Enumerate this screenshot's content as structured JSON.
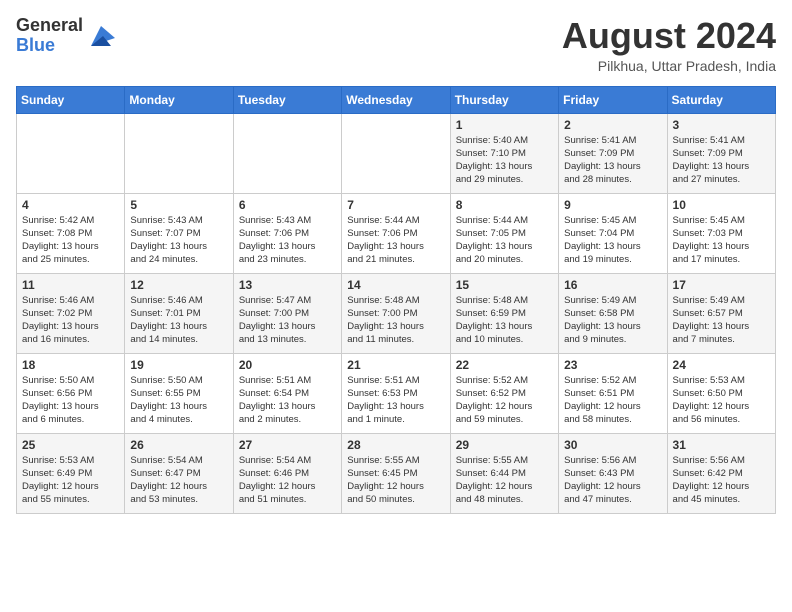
{
  "logo": {
    "general": "General",
    "blue": "Blue"
  },
  "header": {
    "month_year": "August 2024",
    "location": "Pilkhua, Uttar Pradesh, India"
  },
  "weekdays": [
    "Sunday",
    "Monday",
    "Tuesday",
    "Wednesday",
    "Thursday",
    "Friday",
    "Saturday"
  ],
  "weeks": [
    [
      {
        "day": "",
        "info": ""
      },
      {
        "day": "",
        "info": ""
      },
      {
        "day": "",
        "info": ""
      },
      {
        "day": "",
        "info": ""
      },
      {
        "day": "1",
        "info": "Sunrise: 5:40 AM\nSunset: 7:10 PM\nDaylight: 13 hours\nand 29 minutes."
      },
      {
        "day": "2",
        "info": "Sunrise: 5:41 AM\nSunset: 7:09 PM\nDaylight: 13 hours\nand 28 minutes."
      },
      {
        "day": "3",
        "info": "Sunrise: 5:41 AM\nSunset: 7:09 PM\nDaylight: 13 hours\nand 27 minutes."
      }
    ],
    [
      {
        "day": "4",
        "info": "Sunrise: 5:42 AM\nSunset: 7:08 PM\nDaylight: 13 hours\nand 25 minutes."
      },
      {
        "day": "5",
        "info": "Sunrise: 5:43 AM\nSunset: 7:07 PM\nDaylight: 13 hours\nand 24 minutes."
      },
      {
        "day": "6",
        "info": "Sunrise: 5:43 AM\nSunset: 7:06 PM\nDaylight: 13 hours\nand 23 minutes."
      },
      {
        "day": "7",
        "info": "Sunrise: 5:44 AM\nSunset: 7:06 PM\nDaylight: 13 hours\nand 21 minutes."
      },
      {
        "day": "8",
        "info": "Sunrise: 5:44 AM\nSunset: 7:05 PM\nDaylight: 13 hours\nand 20 minutes."
      },
      {
        "day": "9",
        "info": "Sunrise: 5:45 AM\nSunset: 7:04 PM\nDaylight: 13 hours\nand 19 minutes."
      },
      {
        "day": "10",
        "info": "Sunrise: 5:45 AM\nSunset: 7:03 PM\nDaylight: 13 hours\nand 17 minutes."
      }
    ],
    [
      {
        "day": "11",
        "info": "Sunrise: 5:46 AM\nSunset: 7:02 PM\nDaylight: 13 hours\nand 16 minutes."
      },
      {
        "day": "12",
        "info": "Sunrise: 5:46 AM\nSunset: 7:01 PM\nDaylight: 13 hours\nand 14 minutes."
      },
      {
        "day": "13",
        "info": "Sunrise: 5:47 AM\nSunset: 7:00 PM\nDaylight: 13 hours\nand 13 minutes."
      },
      {
        "day": "14",
        "info": "Sunrise: 5:48 AM\nSunset: 7:00 PM\nDaylight: 13 hours\nand 11 minutes."
      },
      {
        "day": "15",
        "info": "Sunrise: 5:48 AM\nSunset: 6:59 PM\nDaylight: 13 hours\nand 10 minutes."
      },
      {
        "day": "16",
        "info": "Sunrise: 5:49 AM\nSunset: 6:58 PM\nDaylight: 13 hours\nand 9 minutes."
      },
      {
        "day": "17",
        "info": "Sunrise: 5:49 AM\nSunset: 6:57 PM\nDaylight: 13 hours\nand 7 minutes."
      }
    ],
    [
      {
        "day": "18",
        "info": "Sunrise: 5:50 AM\nSunset: 6:56 PM\nDaylight: 13 hours\nand 6 minutes."
      },
      {
        "day": "19",
        "info": "Sunrise: 5:50 AM\nSunset: 6:55 PM\nDaylight: 13 hours\nand 4 minutes."
      },
      {
        "day": "20",
        "info": "Sunrise: 5:51 AM\nSunset: 6:54 PM\nDaylight: 13 hours\nand 2 minutes."
      },
      {
        "day": "21",
        "info": "Sunrise: 5:51 AM\nSunset: 6:53 PM\nDaylight: 13 hours\nand 1 minute."
      },
      {
        "day": "22",
        "info": "Sunrise: 5:52 AM\nSunset: 6:52 PM\nDaylight: 12 hours\nand 59 minutes."
      },
      {
        "day": "23",
        "info": "Sunrise: 5:52 AM\nSunset: 6:51 PM\nDaylight: 12 hours\nand 58 minutes."
      },
      {
        "day": "24",
        "info": "Sunrise: 5:53 AM\nSunset: 6:50 PM\nDaylight: 12 hours\nand 56 minutes."
      }
    ],
    [
      {
        "day": "25",
        "info": "Sunrise: 5:53 AM\nSunset: 6:49 PM\nDaylight: 12 hours\nand 55 minutes."
      },
      {
        "day": "26",
        "info": "Sunrise: 5:54 AM\nSunset: 6:47 PM\nDaylight: 12 hours\nand 53 minutes."
      },
      {
        "day": "27",
        "info": "Sunrise: 5:54 AM\nSunset: 6:46 PM\nDaylight: 12 hours\nand 51 minutes."
      },
      {
        "day": "28",
        "info": "Sunrise: 5:55 AM\nSunset: 6:45 PM\nDaylight: 12 hours\nand 50 minutes."
      },
      {
        "day": "29",
        "info": "Sunrise: 5:55 AM\nSunset: 6:44 PM\nDaylight: 12 hours\nand 48 minutes."
      },
      {
        "day": "30",
        "info": "Sunrise: 5:56 AM\nSunset: 6:43 PM\nDaylight: 12 hours\nand 47 minutes."
      },
      {
        "day": "31",
        "info": "Sunrise: 5:56 AM\nSunset: 6:42 PM\nDaylight: 12 hours\nand 45 minutes."
      }
    ]
  ]
}
